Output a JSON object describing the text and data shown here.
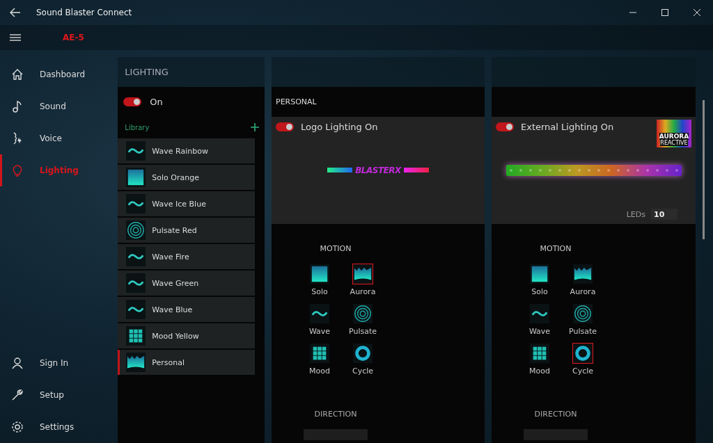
{
  "window": {
    "title": "Sound Blaster Connect"
  },
  "device": "AE-5",
  "nav": {
    "items": [
      {
        "label": "Dashboard",
        "kind": "home",
        "selected": false
      },
      {
        "label": "Sound",
        "kind": "note",
        "selected": false
      },
      {
        "label": "Voice",
        "kind": "voice",
        "selected": false
      },
      {
        "label": "Lighting",
        "kind": "bulb",
        "selected": true
      }
    ],
    "bottom": [
      {
        "label": "Sign In",
        "kind": "person"
      },
      {
        "label": "Setup",
        "kind": "wrench"
      },
      {
        "label": "Settings",
        "kind": "gear"
      }
    ]
  },
  "lighting": {
    "title": "LIGHTING",
    "toggle": {
      "label": "On",
      "on": true
    },
    "library_label": "Library",
    "items": [
      {
        "label": "Wave Rainbow",
        "kind": "wave",
        "selected": false
      },
      {
        "label": "Solo Orange",
        "kind": "solo",
        "selected": false
      },
      {
        "label": "Wave Ice Blue",
        "kind": "wave",
        "selected": false
      },
      {
        "label": "Pulsate Red",
        "kind": "pulsate",
        "selected": false
      },
      {
        "label": "Wave Fire",
        "kind": "wave",
        "selected": false
      },
      {
        "label": "Wave Green",
        "kind": "wave",
        "selected": false
      },
      {
        "label": "Wave Blue",
        "kind": "wave",
        "selected": false
      },
      {
        "label": "Mood Yellow",
        "kind": "mood",
        "selected": false
      },
      {
        "label": "Personal",
        "kind": "aurora",
        "selected": true
      }
    ]
  },
  "personal": {
    "title": "PERSONAL",
    "zones": [
      {
        "toggle": {
          "label": "Logo Lighting On",
          "on": true
        },
        "preview": {
          "kind": "logo",
          "text": "BLASTERX"
        },
        "motion_title": "MOTION",
        "direction_title": "DIRECTION",
        "motions": [
          {
            "label": "Solo",
            "kind": "solo",
            "selected": false
          },
          {
            "label": "Aurora",
            "kind": "aurora",
            "selected": true
          },
          {
            "label": "Wave",
            "kind": "wave",
            "selected": false
          },
          {
            "label": "Pulsate",
            "kind": "pulsate",
            "selected": false
          },
          {
            "label": "Mood",
            "kind": "mood",
            "selected": false
          },
          {
            "label": "Cycle",
            "kind": "cycle",
            "selected": false
          }
        ]
      },
      {
        "toggle": {
          "label": "External Lighting On",
          "on": true
        },
        "badge": {
          "line1": "AURORA",
          "line2": "REACTIVE"
        },
        "preview": {
          "kind": "strip"
        },
        "leds": {
          "label": "LEDs",
          "value": "10"
        },
        "motion_title": "MOTION",
        "direction_title": "DIRECTION",
        "motions": [
          {
            "label": "Solo",
            "kind": "solo",
            "selected": false
          },
          {
            "label": "Aurora",
            "kind": "aurora",
            "selected": false
          },
          {
            "label": "Wave",
            "kind": "wave",
            "selected": false
          },
          {
            "label": "Pulsate",
            "kind": "pulsate",
            "selected": false
          },
          {
            "label": "Mood",
            "kind": "mood",
            "selected": false
          },
          {
            "label": "Cycle",
            "kind": "cycle",
            "selected": true
          }
        ]
      }
    ]
  }
}
